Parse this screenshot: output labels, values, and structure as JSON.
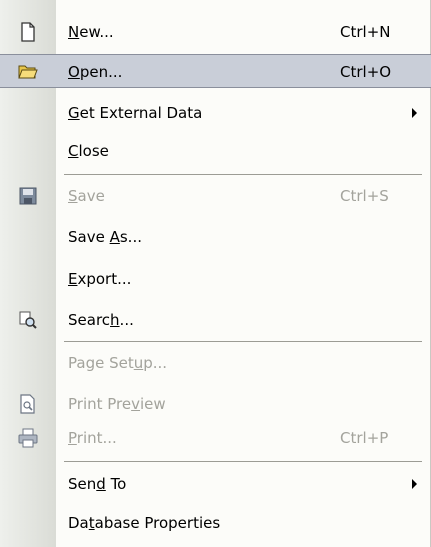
{
  "menu": {
    "items": [
      {
        "id": "new",
        "pre": "",
        "u": "N",
        "post": "ew...",
        "shortcut": "Ctrl+N",
        "icon": "new-document-icon",
        "disabled": false,
        "highlight": false,
        "submenu": false
      },
      {
        "id": "open",
        "pre": "",
        "u": "O",
        "post": "pen...",
        "shortcut": "Ctrl+O",
        "icon": "open-folder-icon",
        "disabled": false,
        "highlight": true,
        "submenu": false
      },
      {
        "id": "get-external-data",
        "pre": "",
        "u": "G",
        "post": "et External Data",
        "shortcut": "",
        "icon": "",
        "disabled": false,
        "highlight": false,
        "submenu": true
      },
      {
        "id": "close",
        "pre": "",
        "u": "C",
        "post": "lose",
        "shortcut": "",
        "icon": "",
        "disabled": false,
        "highlight": false,
        "submenu": false
      },
      {
        "id": "save",
        "pre": "",
        "u": "S",
        "post": "ave",
        "shortcut": "Ctrl+S",
        "icon": "save-disk-icon",
        "disabled": true,
        "highlight": false,
        "submenu": false
      },
      {
        "id": "save-as",
        "pre": "Save ",
        "u": "A",
        "post": "s...",
        "shortcut": "",
        "icon": "",
        "disabled": false,
        "highlight": false,
        "submenu": false
      },
      {
        "id": "export",
        "pre": "",
        "u": "E",
        "post": "xport...",
        "shortcut": "",
        "icon": "",
        "disabled": false,
        "highlight": false,
        "submenu": false
      },
      {
        "id": "search",
        "pre": "Searc",
        "u": "h",
        "post": "...",
        "shortcut": "",
        "icon": "search-file-icon",
        "disabled": false,
        "highlight": false,
        "submenu": false
      },
      {
        "id": "page-setup",
        "pre": "Page Set",
        "u": "u",
        "post": "p...",
        "shortcut": "",
        "icon": "",
        "disabled": true,
        "highlight": false,
        "submenu": false
      },
      {
        "id": "print-preview",
        "pre": "Print Pre",
        "u": "v",
        "post": "iew",
        "shortcut": "",
        "icon": "print-preview-icon",
        "disabled": true,
        "highlight": false,
        "submenu": false
      },
      {
        "id": "print",
        "pre": "",
        "u": "P",
        "post": "rint...",
        "shortcut": "Ctrl+P",
        "icon": "printer-icon",
        "disabled": true,
        "highlight": false,
        "submenu": false
      },
      {
        "id": "send-to",
        "pre": "Sen",
        "u": "d",
        "post": " To",
        "shortcut": "",
        "icon": "",
        "disabled": false,
        "highlight": false,
        "submenu": true
      },
      {
        "id": "database-properties",
        "pre": "Da",
        "u": "t",
        "post": "abase Properties",
        "shortcut": "",
        "icon": "",
        "disabled": false,
        "highlight": false,
        "submenu": false
      }
    ],
    "colors": {
      "menu_bg": "#fcfcf9",
      "gutter": "#dadcd6",
      "highlight": "#c9ced8",
      "disabled_text": "#a3a39c"
    }
  }
}
